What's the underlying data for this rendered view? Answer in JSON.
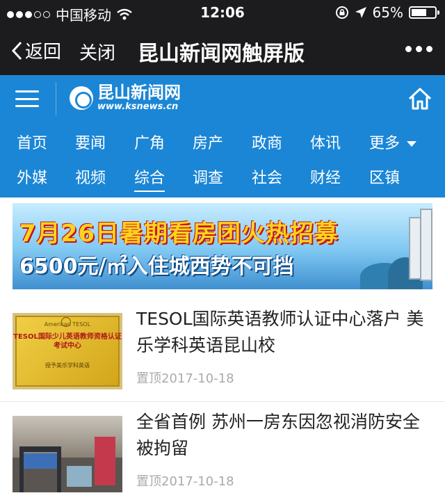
{
  "status_bar": {
    "carrier": "中国移动",
    "time": "12:06",
    "battery": "65%",
    "battery_level": 0.65
  },
  "nav_bar": {
    "back_label": "返回",
    "close_label": "关闭",
    "title": "昆山新闻网触屏版"
  },
  "site_header": {
    "logo_name": "昆山新闻网",
    "logo_url": "www.ksnews.cn",
    "icons": [
      "menu-icon",
      "home-icon"
    ]
  },
  "categories": {
    "row1": [
      "首页",
      "要闻",
      "广角",
      "房产",
      "政商",
      "体讯",
      "更多"
    ],
    "row2": [
      "外媒",
      "视频",
      "综合",
      "调查",
      "社会",
      "财经",
      "区镇"
    ],
    "active": "综合"
  },
  "banner": {
    "line1": "7月26日暑期看房团火热招募",
    "line2": "6500元/㎡入住城西势不可挡"
  },
  "news": [
    {
      "title": "TESOL国际英语教师认证中心落户 美乐学科英语昆山校",
      "tag": "置顶",
      "date": "2017-10-18",
      "thumb_text": {
        "top": "American TESOL",
        "main": "TESOL国际少儿英语教师资格认证考试中心",
        "sub": "授予美乐学科英语"
      }
    },
    {
      "title": "全省首例 苏州一房东因忽视消防安全被拘留",
      "tag": "置顶",
      "date": "2017-10-18"
    }
  ],
  "colors": {
    "header_blue": "#1b86d6",
    "dark_bar": "#1c1c1e"
  }
}
